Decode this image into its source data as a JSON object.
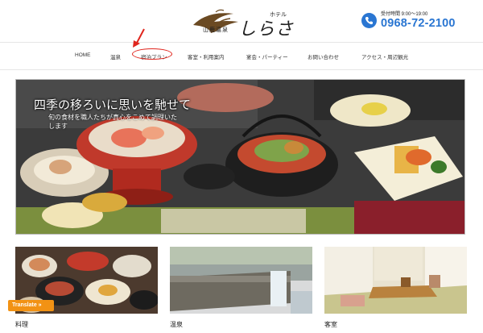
{
  "header": {
    "logo": {
      "small_text": "山鹿温泉",
      "hotel_text": "ホテル",
      "name_text": "しらさぎ"
    },
    "contact": {
      "hours": "受付時間 9:00～19:00",
      "phone": "0968-72-2100",
      "icon": "phone-icon"
    }
  },
  "nav": {
    "items": [
      {
        "label": "HOME"
      },
      {
        "label": "温泉"
      },
      {
        "label": "宿泊プラン"
      },
      {
        "label": "客室・利用案内"
      },
      {
        "label": "宴会・パーティー"
      },
      {
        "label": "お問い合わせ"
      },
      {
        "label": "アクセス・周辺観光"
      }
    ]
  },
  "hero": {
    "title": "四季の移ろいに思いを馳せて",
    "subtitle": "旬の食材を職人たちが真心をこめて調理いたします"
  },
  "cards": [
    {
      "label": "料理"
    },
    {
      "label": "温泉"
    },
    {
      "label": "客室"
    }
  ],
  "translate": {
    "label": "Translate »"
  },
  "colors": {
    "accent_blue": "#2a76d2",
    "annotation_red": "#e0261e",
    "translate_orange": "#f29214"
  }
}
